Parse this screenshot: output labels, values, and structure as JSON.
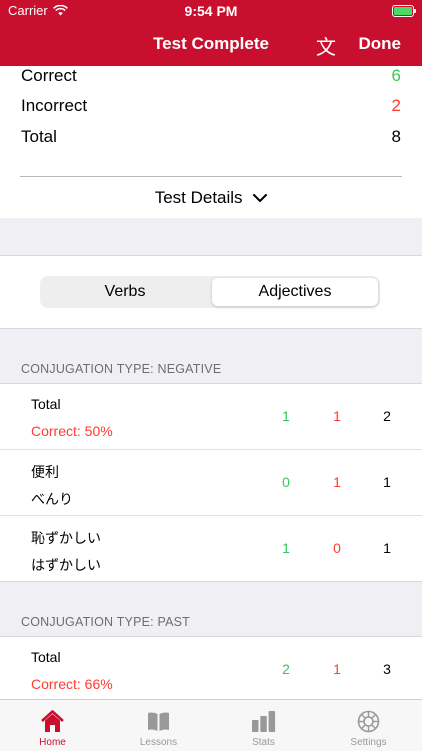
{
  "status_bar": {
    "carrier": "Carrier",
    "time": "9:54 PM"
  },
  "nav": {
    "title": "Test Complete",
    "translate_glyph": "文",
    "done_label": "Done"
  },
  "summary": {
    "correct_label": "Correct",
    "correct_value": "6",
    "incorrect_label": "Incorrect",
    "incorrect_value": "2",
    "total_label": "Total",
    "total_value": "8",
    "details_label": "Test Details"
  },
  "segments": {
    "verbs": "Verbs",
    "adjectives": "Adjectives",
    "selected": "adjectives"
  },
  "sections": [
    {
      "header": "CONJUGATION TYPE: NEGATIVE",
      "rows": [
        {
          "line1": "Total",
          "line2": "Correct: 50%",
          "correct": "1",
          "incorrect": "1",
          "total": "2"
        },
        {
          "line1": "便利",
          "line2": "べんり",
          "correct": "0",
          "incorrect": "1",
          "total": "1"
        },
        {
          "line1": "恥ずかしい",
          "line2": "はずかしい",
          "correct": "1",
          "incorrect": "0",
          "total": "1"
        }
      ]
    },
    {
      "header": "CONJUGATION TYPE: PAST",
      "rows": [
        {
          "line1": "Total",
          "line2": "Correct: 66%",
          "correct": "2",
          "incorrect": "1",
          "total": "3"
        }
      ]
    }
  ],
  "tabs": [
    {
      "label": "Home",
      "icon": "home-icon",
      "active": true
    },
    {
      "label": "Lessons",
      "icon": "book-icon",
      "active": false
    },
    {
      "label": "Stats",
      "icon": "bar-chart-icon",
      "active": false
    },
    {
      "label": "Settings",
      "icon": "gear-icon",
      "active": false
    }
  ],
  "colors": {
    "accent": "#c8102e",
    "correct": "#34c759",
    "incorrect": "#ff3b30"
  }
}
